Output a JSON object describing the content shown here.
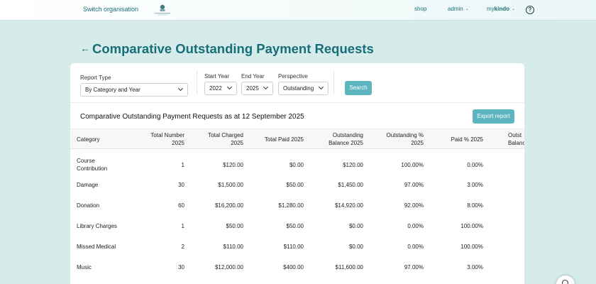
{
  "nav": {
    "switch_org": "Switch organisation",
    "shop": "shop",
    "admin": "admin",
    "mykindo_prefix": "my",
    "mykindo_suffix": "kindo",
    "help": "?"
  },
  "page": {
    "title": "Comparative Outstanding Payment Requests"
  },
  "filters": {
    "report_type_label": "Report Type",
    "report_type_value": "By Category and Year",
    "start_year_label": "Start Year",
    "start_year_value": "2022",
    "end_year_label": "End Year",
    "end_year_value": "2025",
    "perspective_label": "Perspective",
    "perspective_value": "Outstanding",
    "search_label": "Search"
  },
  "report": {
    "heading": "Comparative Outstanding Payment Requests as at 12 September 2025",
    "export_label": "Export report"
  },
  "table": {
    "headers": [
      [
        "Category",
        ""
      ],
      [
        "Total Number",
        "2025"
      ],
      [
        "Total Charged",
        "2025"
      ],
      [
        "Total Paid 2025",
        ""
      ],
      [
        "Outstanding",
        "Balance 2025"
      ],
      [
        "Outstanding %",
        "2025"
      ],
      [
        "Paid % 2025",
        ""
      ],
      [
        "Outst",
        "Balanc"
      ]
    ],
    "rows": [
      {
        "category": [
          "Course",
          "Contribution"
        ],
        "number": "1",
        "charged": "$120.00",
        "paid": "$0.00",
        "balance": "$120.00",
        "out_pct": "100.00%",
        "paid_pct": "0.00%"
      },
      {
        "category": [
          "Damage",
          ""
        ],
        "number": "30",
        "charged": "$1,500.00",
        "paid": "$50.00",
        "balance": "$1,450.00",
        "out_pct": "97.00%",
        "paid_pct": "3.00%"
      },
      {
        "category": [
          "Donation",
          ""
        ],
        "number": "60",
        "charged": "$16,200.00",
        "paid": "$1,280.00",
        "balance": "$14,920.00",
        "out_pct": "92.00%",
        "paid_pct": "8.00%"
      },
      {
        "category": [
          "Library Charges",
          ""
        ],
        "number": "1",
        "charged": "$50.00",
        "paid": "$50.00",
        "balance": "$0.00",
        "out_pct": "0.00%",
        "paid_pct": "100.00%"
      },
      {
        "category": [
          "Missed Medical",
          ""
        ],
        "number": "2",
        "charged": "$110.00",
        "paid": "$110.00",
        "balance": "$0.00",
        "out_pct": "0.00%",
        "paid_pct": "100.00%"
      },
      {
        "category": [
          "Music",
          ""
        ],
        "number": "30",
        "charged": "$12,000.00",
        "paid": "$400.00",
        "balance": "$11,600.00",
        "out_pct": "97.00%",
        "paid_pct": "3.00%"
      }
    ]
  },
  "colors": {
    "accent": "#5eb5bf",
    "title": "#176e78",
    "background": "#d5ecea"
  }
}
